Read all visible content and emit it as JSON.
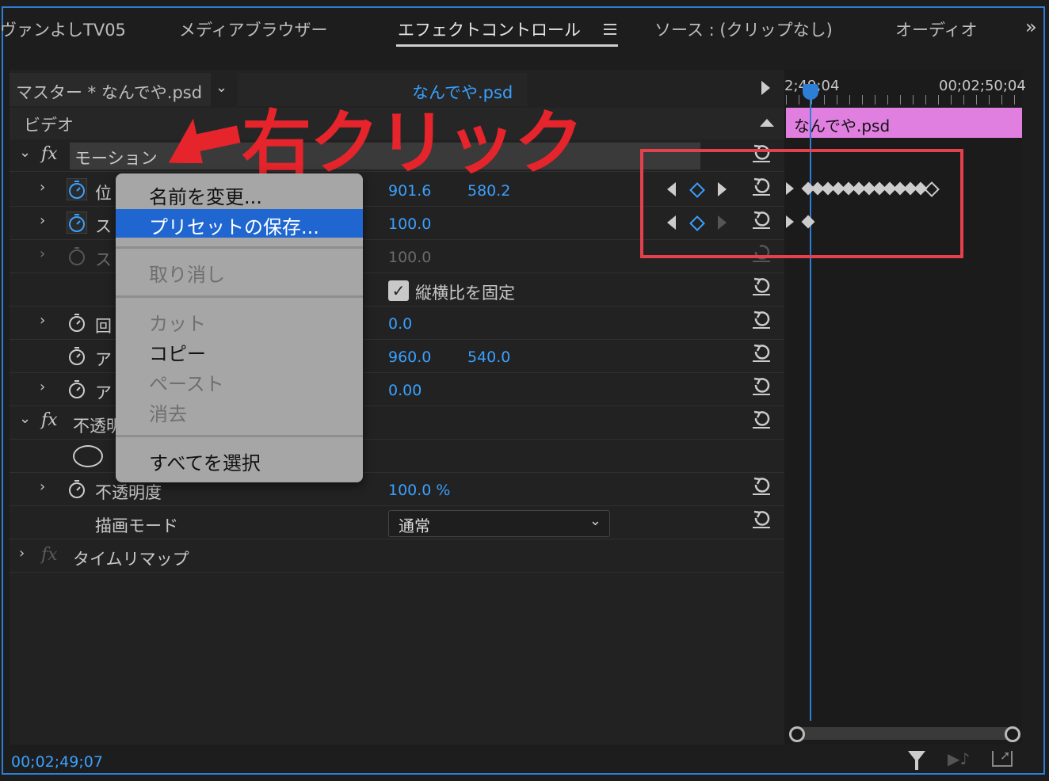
{
  "tabs": [
    {
      "label": "ヴァンよしTV05"
    },
    {
      "label": "メディアブラウザー"
    },
    {
      "label": "エフェクトコントロール"
    },
    {
      "label": "ソース : (クリップなし)"
    },
    {
      "label": "オーディオ"
    }
  ],
  "tab_menu_icon": "hamburger-icon",
  "overflow_icon": "double-chevron-right-icon",
  "clip_header": {
    "master": "マスター * なんでや.psd",
    "clip": "なんでや.psd"
  },
  "video_label": "ビデオ",
  "annotation": {
    "text": "右クリック",
    "color": "#e5242b"
  },
  "effects": {
    "motion_label": "モーション",
    "position_label": "位",
    "scale_label": "ス",
    "scale_width_label": "ス",
    "rotation_label": "回",
    "anchor_label": "ア",
    "antiflicker_label": "ア",
    "position_x": "901.6",
    "position_y": "580.2",
    "scale": "100.0",
    "scale_width": "100.0",
    "uniform_scale": "縦横比を固定",
    "rotation": "0.0",
    "anchor_x": "960.0",
    "anchor_y": "540.0",
    "antiflicker": "0.00",
    "opacity_group_label": "不透明",
    "opacity_label": "不透明度",
    "opacity_value": "100.0 %",
    "blend_label": "描画モード",
    "blend_value": "通常",
    "timeremap_label": "タイムリマップ"
  },
  "context_menu": {
    "items": [
      "名前を変更...",
      "プリセットの保存...",
      "取り消し",
      "カット",
      "コピー",
      "ペースト",
      "消去",
      "すべてを選択"
    ],
    "highlighted": "プリセットの保存...",
    "highlight_color": "#1f66d1"
  },
  "timeline": {
    "time_left": "2;49;04",
    "time_right": "00;02;50;04",
    "clip_name": "なんでや.psd",
    "clip_color": "#e07fe0",
    "highlight_box_color": "#e5404e"
  },
  "footer": {
    "timecode": "00;02;49;07"
  },
  "colors": {
    "accent": "#3aa0ff",
    "panel_border": "#2d7fd6"
  }
}
